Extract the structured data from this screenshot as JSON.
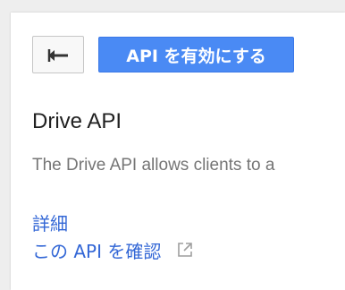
{
  "toolbar": {
    "back_icon": "back-arrow-icon",
    "enable_label": "API を有効にする"
  },
  "api": {
    "title": "Drive API",
    "description": "The Drive API allows clients to a"
  },
  "links": {
    "details_label": "詳細",
    "try_label": "この API を確認",
    "external_icon": "external-link-icon"
  },
  "colors": {
    "primary_button": "#4a8af4",
    "link": "#3367d6",
    "title": "#212121",
    "description": "#757575"
  }
}
